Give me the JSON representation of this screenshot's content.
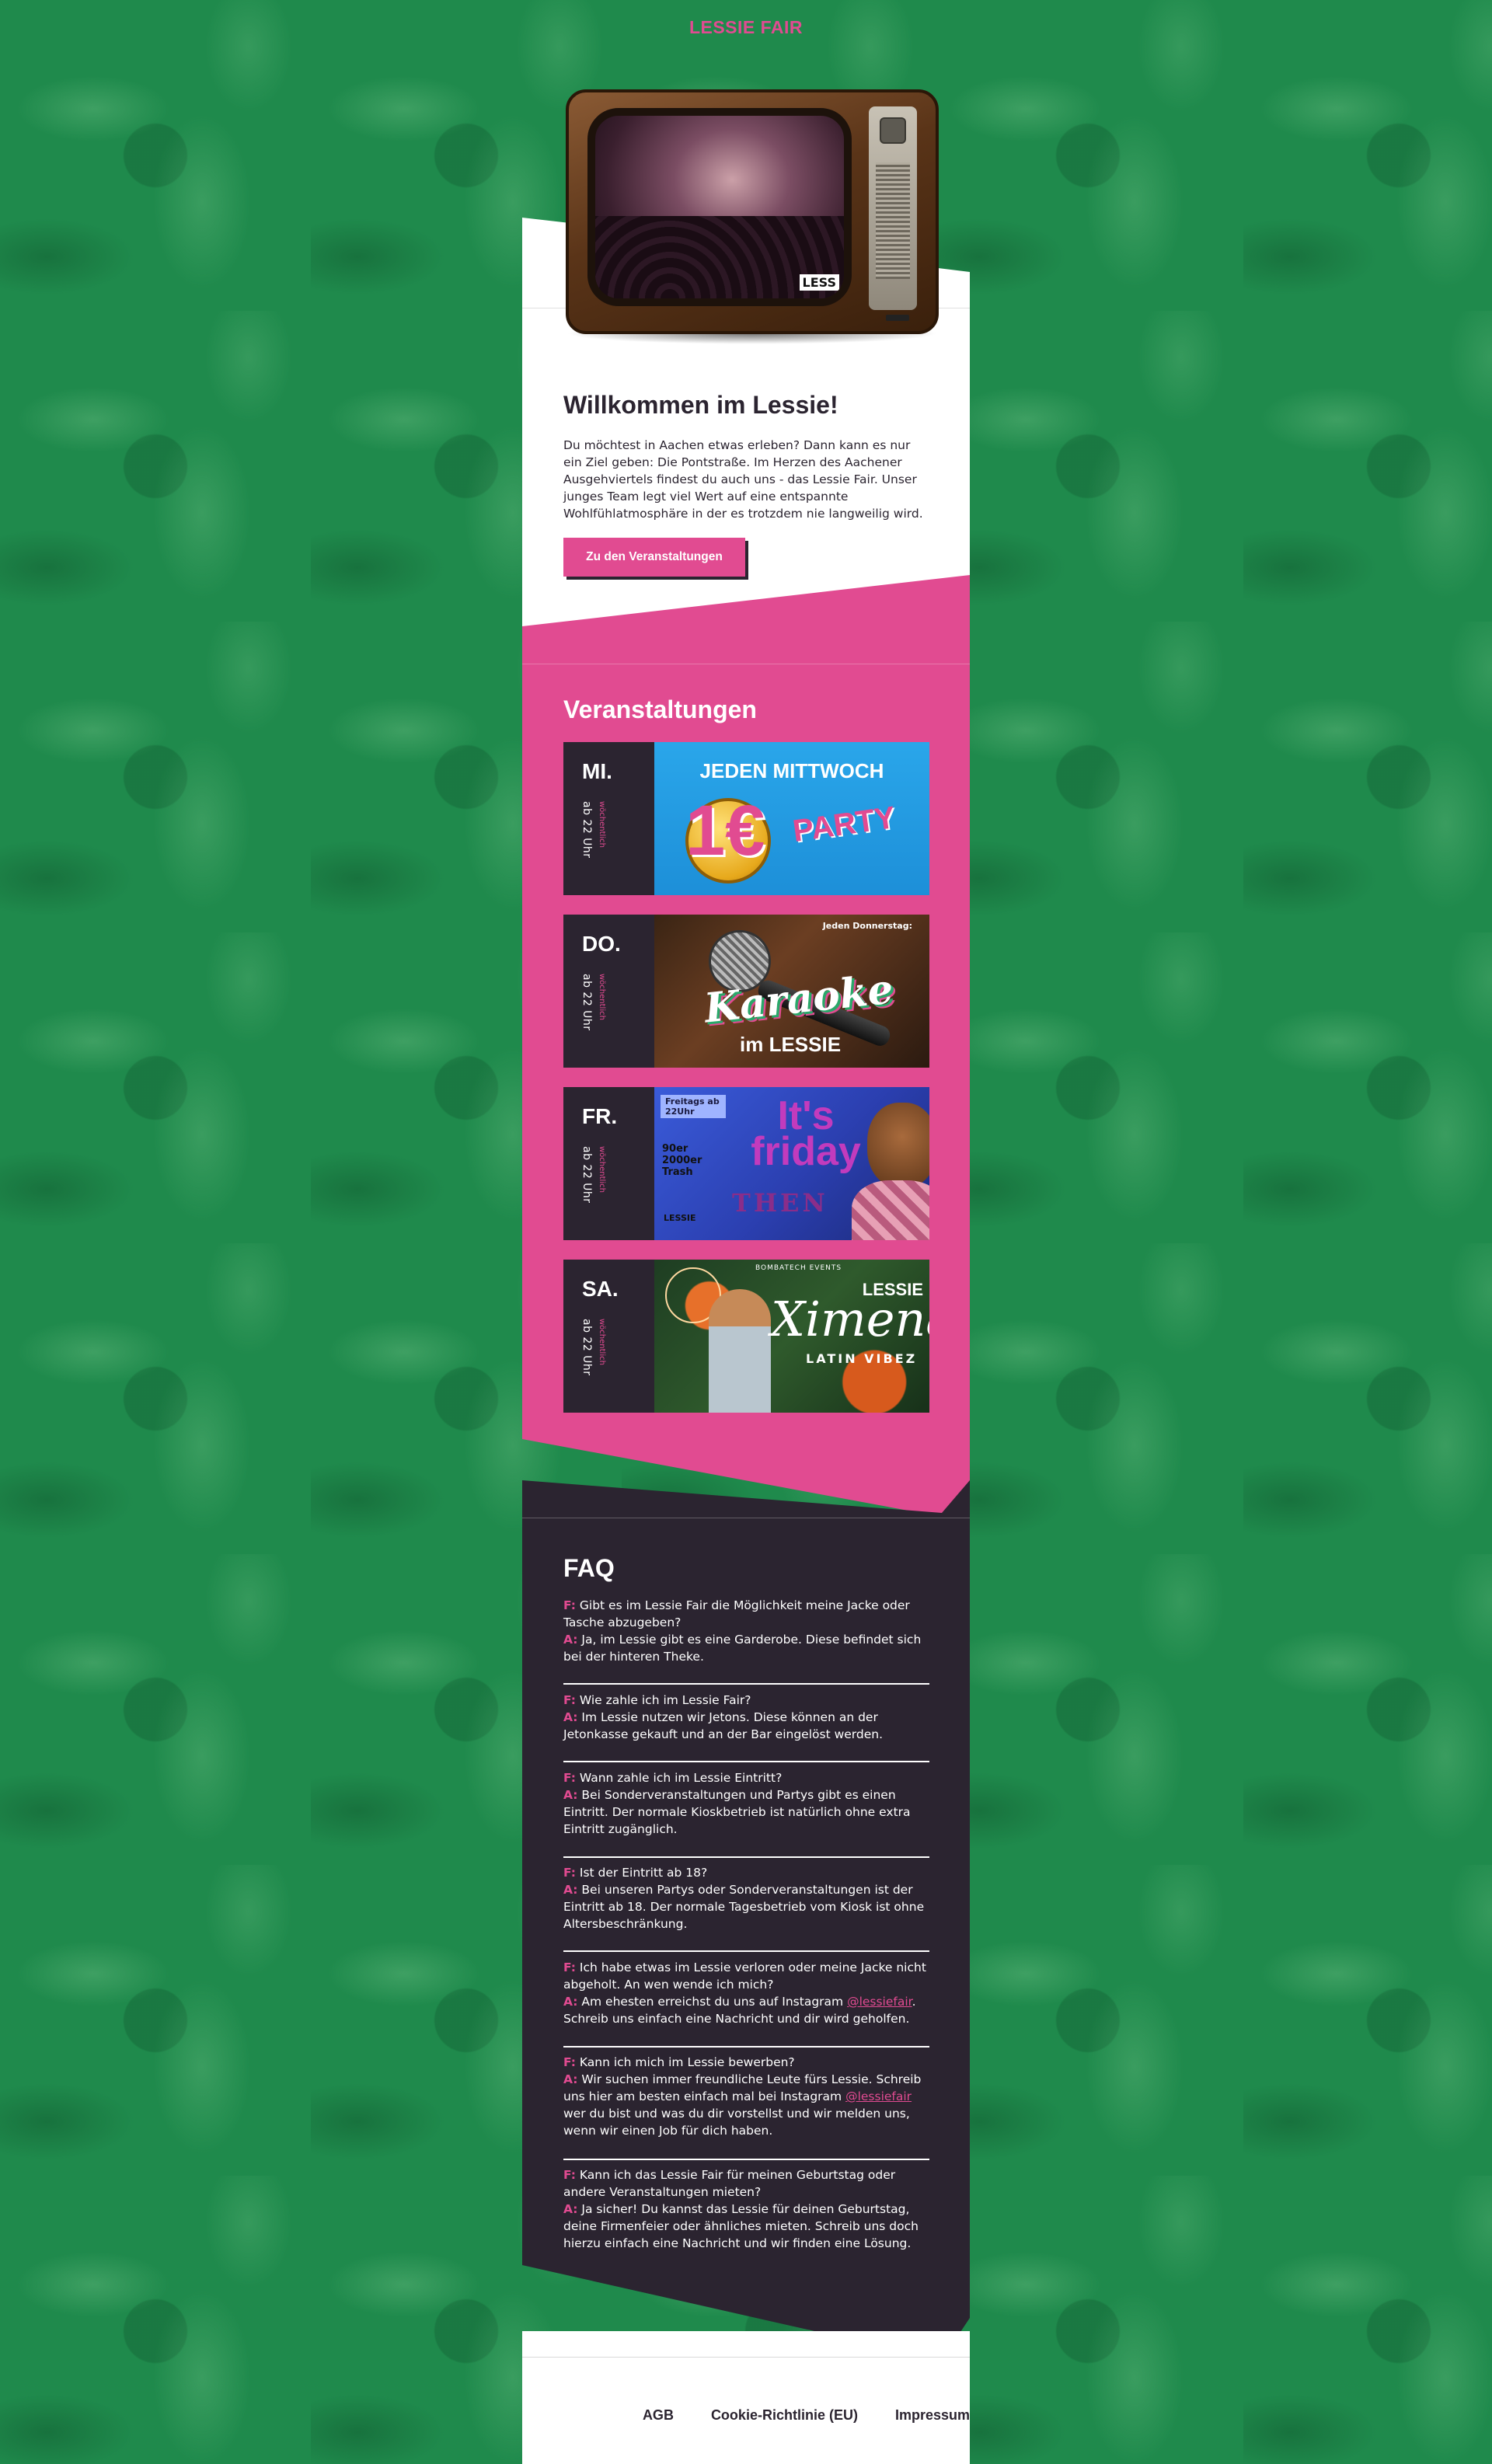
{
  "header": {
    "brand": "LESSIE FAIR"
  },
  "tv": {
    "screen_logo": "LESS"
  },
  "intro": {
    "title": "Willkommen im Lessie!",
    "text": "Du möchtest in Aachen etwas erleben? Dann kann es nur ein Ziel geben: Die Pontstraße. Im Herzen des Aachener Ausgehviertels findest du auch uns - das Lessie Fair. Unser junges Team legt viel Wert auf eine entspannte Wohlfühlatmosphäre in der es trotzdem nie langweilig wird.",
    "button_label": "Zu den Veranstaltungen"
  },
  "events": {
    "title": "Veranstaltungen",
    "items": [
      {
        "day": "MI.",
        "time": "ab 22 Uhr",
        "frequency": "wöchentlich",
        "poster": {
          "headline": "JEDEN MITTWOCH",
          "big": "1€",
          "party": "PARTY"
        }
      },
      {
        "day": "DO.",
        "time": "ab 22 Uhr",
        "frequency": "wöchentlich",
        "poster": {
          "top": "Jeden Donnerstag:",
          "word": "Karaoke",
          "im": "im LESSIE"
        }
      },
      {
        "day": "FR.",
        "time": "ab 22 Uhr",
        "frequency": "wöchentlich",
        "poster": {
          "badge": "Freitags ab 22Uhr",
          "list": "90er 2000er Trash",
          "its": "It's friday",
          "then": "THEN",
          "logo": "LESSIE"
        }
      },
      {
        "day": "SA.",
        "time": "ab 22 Uhr",
        "frequency": "wöchentlich",
        "poster": {
          "top": "BOMBATECH EVENTS",
          "name": "Ximena",
          "sub": "LATIN VIBEZ",
          "logo": "LESSIE"
        }
      }
    ]
  },
  "faq": {
    "title": "FAQ",
    "q_label": "F:",
    "a_label": "A:",
    "items": [
      {
        "q": "Gibt es im Lessie Fair die Möglichkeit meine Jacke oder Tasche abzugeben?",
        "a": "Ja, im Lessie gibt es eine Garderobe. Diese befindet sich bei der hinteren Theke."
      },
      {
        "q": "Wie zahle ich im Lessie Fair?",
        "a": "Im Lessie nutzen wir Jetons. Diese können an der Jetonkasse gekauft und an der Bar eingelöst werden."
      },
      {
        "q": "Wann zahle ich im Lessie Eintritt?",
        "a": "Bei Sonderveranstaltungen und Partys gibt es einen Eintritt. Der normale Kioskbetrieb ist natürlich ohne extra Eintritt zugänglich."
      },
      {
        "q": "Ist der Eintritt ab 18?",
        "a": "Bei unseren Partys oder Sonderveranstaltungen ist der Eintritt ab 18. Der normale Tagesbetrieb vom Kiosk ist ohne Altersbeschränkung."
      },
      {
        "q": "Ich habe etwas im Lessie verloren oder meine Jacke nicht abgeholt. An wen wende ich mich?",
        "a_pre": "Am ehesten erreichst du uns auf Instagram ",
        "a_link": "@lessiefair",
        "a_post": ". Schreib uns einfach eine Nachricht und dir wird geholfen."
      },
      {
        "q": "Kann ich mich im Lessie bewerben?",
        "a_pre": "Wir suchen immer freundliche Leute fürs Lessie. Schreib uns hier am besten einfach mal bei Instagram ",
        "a_link": "@lessiefair",
        "a_post": " wer du bist und was du dir vorstellst und wir melden uns, wenn wir einen Job für dich haben."
      },
      {
        "q": "Kann ich das Lessie Fair für meinen Geburtstag oder andere Veranstaltungen mieten?",
        "a": "Ja sicher! Du kannst das Lessie für deinen Geburtstag, deine Firmenfeier oder ähnliches mieten. Schreib uns doch hierzu einfach eine Nachricht und wir finden eine Lösung."
      }
    ]
  },
  "footer": {
    "links": [
      "AGB",
      "Cookie-Richtlinie (EU)",
      "Impressum"
    ]
  },
  "colors": {
    "pink": "#e14b91",
    "dark": "#2b2430",
    "green": "#1f8a4c",
    "white": "#ffffff"
  }
}
